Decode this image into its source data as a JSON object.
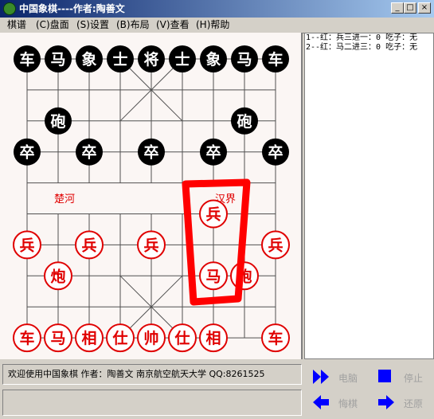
{
  "window": {
    "title": "中国象棋----作者:陶善文",
    "minimize": "_",
    "maximize": "□",
    "close": "×"
  },
  "menu": {
    "items": [
      {
        "label": "棋谱"
      },
      {
        "label": "(C)盘面"
      },
      {
        "label": "(S)设置"
      },
      {
        "label": "(B)布局"
      },
      {
        "label": "(V)查看"
      },
      {
        "label": "(H)帮助"
      }
    ]
  },
  "board": {
    "river_left": "楚河",
    "river_right": "汉界",
    "colors": {
      "red": "#e00000",
      "black": "#000000",
      "grid": "#505050",
      "annotation": "#ff0000"
    },
    "black_pieces": [
      {
        "label": "车",
        "col": 0,
        "row": 0
      },
      {
        "label": "马",
        "col": 1,
        "row": 0
      },
      {
        "label": "象",
        "col": 2,
        "row": 0
      },
      {
        "label": "士",
        "col": 3,
        "row": 0
      },
      {
        "label": "将",
        "col": 4,
        "row": 0
      },
      {
        "label": "士",
        "col": 5,
        "row": 0
      },
      {
        "label": "象",
        "col": 6,
        "row": 0
      },
      {
        "label": "马",
        "col": 7,
        "row": 0
      },
      {
        "label": "车",
        "col": 8,
        "row": 0
      },
      {
        "label": "砲",
        "col": 1,
        "row": 2
      },
      {
        "label": "砲",
        "col": 7,
        "row": 2
      },
      {
        "label": "卒",
        "col": 0,
        "row": 3
      },
      {
        "label": "卒",
        "col": 2,
        "row": 3
      },
      {
        "label": "卒",
        "col": 4,
        "row": 3
      },
      {
        "label": "卒",
        "col": 6,
        "row": 3
      },
      {
        "label": "卒",
        "col": 8,
        "row": 3
      }
    ],
    "red_pieces": [
      {
        "label": "兵",
        "col": 6,
        "row": 5
      },
      {
        "label": "兵",
        "col": 0,
        "row": 6
      },
      {
        "label": "兵",
        "col": 2,
        "row": 6
      },
      {
        "label": "兵",
        "col": 4,
        "row": 6
      },
      {
        "label": "兵",
        "col": 8,
        "row": 6
      },
      {
        "label": "炮",
        "col": 1,
        "row": 7
      },
      {
        "label": "马",
        "col": 6,
        "row": 7
      },
      {
        "label": "炮",
        "col": 7,
        "row": 7
      },
      {
        "label": "车",
        "col": 0,
        "row": 9
      },
      {
        "label": "马",
        "col": 1,
        "row": 9
      },
      {
        "label": "相",
        "col": 2,
        "row": 9
      },
      {
        "label": "仕",
        "col": 3,
        "row": 9
      },
      {
        "label": "帅",
        "col": 4,
        "row": 9
      },
      {
        "label": "仕",
        "col": 5,
        "row": 9
      },
      {
        "label": "相",
        "col": 6,
        "row": 9
      },
      {
        "label": "车",
        "col": 8,
        "row": 9
      }
    ]
  },
  "moves": [
    "1--红：兵三进一：0 吃子：无",
    "2--红：马二进三：0 吃子：无"
  ],
  "status": {
    "line1": "欢迎使用中国象棋  作者：陶善文  南京航空航天大学    QQ:8261525",
    "line2": ""
  },
  "controls": {
    "computer": "电脑",
    "stop": "停止",
    "undo": "悔棋",
    "restore": "还原",
    "icon_color": "#0000ff"
  }
}
